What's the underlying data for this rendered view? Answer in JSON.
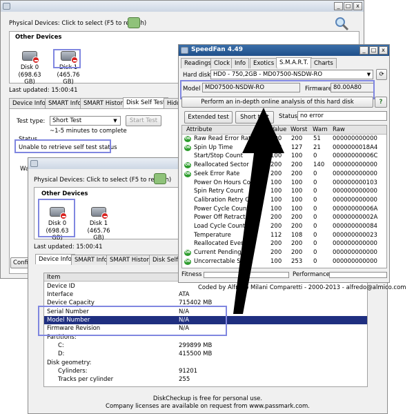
{
  "win1": {
    "physical_devices_label": "Physical Devices: Click to select (F5 to refresh)",
    "other_devices": "Other Devices",
    "disks": [
      {
        "name": "Disk 0",
        "size": "(698.63 GB)"
      },
      {
        "name": "Disk 1",
        "size": "(465.76 GB)"
      }
    ],
    "last_updated": "Last updated: 15:00:41",
    "tabs": [
      "Device Info",
      "SMART Info",
      "SMART History",
      "Disk Self Test",
      "Hidde"
    ],
    "test_type_label": "Test type:",
    "test_type_value": "Short Test",
    "start_test": "Start Test",
    "minutes_note": "~1-5 minutes to complete",
    "status_label": "Status",
    "status_value": "Unable to retrieve self test status",
    "wa_fragment": "Wa",
    "conf_fragment": "Confi"
  },
  "win2": {
    "physical_devices_label": "Physical Devices: Click to select (F5 to refresh)",
    "other_devices": "Other Devices",
    "disks": [
      {
        "name": "Disk 0",
        "size": "(698.63 GB)"
      },
      {
        "name": "Disk 1",
        "size": "(465.76 GB)"
      }
    ],
    "last_updated": "Last updated: 15:00:41",
    "tabs": [
      "Device Info",
      "SMART Info",
      "SMART History",
      "Disk Self T"
    ],
    "table_header": "Item",
    "rows": [
      {
        "item": "Device ID",
        "value": ""
      },
      {
        "item": "Interface",
        "value": "ATA"
      },
      {
        "item": "Device Capacity",
        "value": "715402 MB"
      },
      {
        "item": "Serial Number",
        "value": "N/A"
      },
      {
        "item": "Model Number",
        "value": "N/A"
      },
      {
        "item": "Firmware Revision",
        "value": "N/A"
      },
      {
        "item": "Partitions:",
        "value": ""
      },
      {
        "item": "C:",
        "value": "299899 MB"
      },
      {
        "item": "D:",
        "value": "415500 MB"
      },
      {
        "item": "Disk geometry:",
        "value": ""
      },
      {
        "item": "Cylinders:",
        "value": "91201"
      },
      {
        "item": "Tracks per cylinder",
        "value": "255"
      }
    ],
    "footer_line1": "DiskCheckup is free for personal use.",
    "footer_line2": "Company licenses are available on request from www.passmark.com."
  },
  "speedfan": {
    "title": "SpeedFan 4.49",
    "tabs": [
      "Readings",
      "Clock",
      "Info",
      "Exotics",
      "S.M.A.R.T.",
      "Charts"
    ],
    "hard_disk_label": "Hard disk",
    "hard_disk_value": "HD0 - 750,2GB - MD07500-NSDW-RO",
    "model_label": "Model",
    "model_value": "MD07500-NSDW-RO",
    "firmware_label": "Firmware",
    "firmware_value": "80.00A80",
    "online_analysis": "Perform an in-depth online analysis of this hard disk",
    "extended_test": "Extended test",
    "short_test": "Short test",
    "status_label": "Status",
    "status_value": "no error",
    "columns": {
      "attribute": "Attribute",
      "value": "Value",
      "worst": "Worst",
      "warn": "Warn",
      "raw": "Raw"
    },
    "attributes": [
      {
        "ok": true,
        "name": "Raw Read Error Rate",
        "value": "200",
        "worst": "200",
        "warn": "51",
        "raw": "000000000000"
      },
      {
        "ok": true,
        "name": "Spin Up Time",
        "value": "133",
        "worst": "127",
        "warn": "21",
        "raw": "0000000018A4"
      },
      {
        "ok": false,
        "name": "Start/Stop Count",
        "value": "100",
        "worst": "100",
        "warn": "0",
        "raw": "00000000006C"
      },
      {
        "ok": true,
        "name": "Reallocated Sector",
        "value": "200",
        "worst": "200",
        "warn": "140",
        "raw": "000000000000"
      },
      {
        "ok": true,
        "name": "Seek Error Rate",
        "value": "200",
        "worst": "200",
        "warn": "0",
        "raw": "000000000000"
      },
      {
        "ok": false,
        "name": "Power On Hours Count",
        "value": "100",
        "worst": "100",
        "warn": "0",
        "raw": "000000000103"
      },
      {
        "ok": false,
        "name": "Spin Retry Count",
        "value": "100",
        "worst": "100",
        "warn": "0",
        "raw": "000000000000"
      },
      {
        "ok": false,
        "name": "Calibration Retry Count",
        "value": "100",
        "worst": "100",
        "warn": "0",
        "raw": "000000000000"
      },
      {
        "ok": false,
        "name": "Power Cycle Count",
        "value": "100",
        "worst": "100",
        "warn": "0",
        "raw": "00000000006A"
      },
      {
        "ok": false,
        "name": "Power Off Retract Co",
        "value": "200",
        "worst": "200",
        "warn": "0",
        "raw": "00000000002A"
      },
      {
        "ok": false,
        "name": "Load Cycle Count",
        "value": "200",
        "worst": "200",
        "warn": "0",
        "raw": "000000000084"
      },
      {
        "ok": false,
        "name": "Temperature",
        "value": "112",
        "worst": "108",
        "warn": "0",
        "raw": "000000000023"
      },
      {
        "ok": false,
        "name": "Reallocated Event C",
        "value": "200",
        "worst": "200",
        "warn": "0",
        "raw": "000000000000"
      },
      {
        "ok": true,
        "name": "Current Pending Se",
        "value": "200",
        "worst": "200",
        "warn": "0",
        "raw": "000000000000"
      },
      {
        "ok": true,
        "name": "Uncorrectable Se",
        "value": "100",
        "worst": "253",
        "warn": "0",
        "raw": "000000000000"
      }
    ],
    "fitness_label": "Fitness",
    "performance_label": "Performance",
    "credits": "Coded by Alfredo Milani Comparetti - 2000-2013 - alfredo@almico.com",
    "colors": {
      "ok_icon": "#2e9d2e",
      "highlight": "#7f86e0",
      "selected_row": "#1f2f80"
    }
  }
}
